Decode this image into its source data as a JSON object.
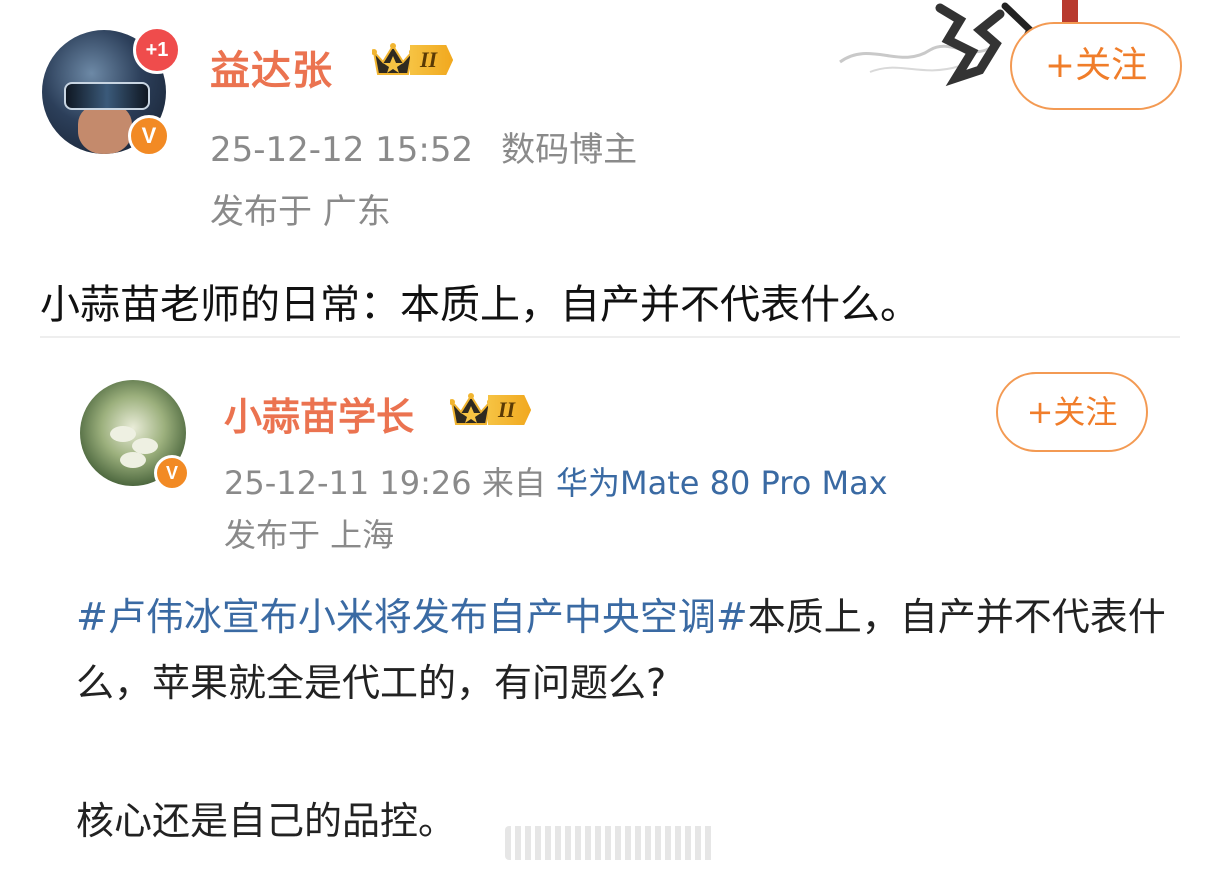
{
  "main_post": {
    "username": "益达张",
    "level": "II",
    "notification_badge": "+1",
    "verified_badge": "V",
    "follow_label": "+关注",
    "timestamp": "25-12-12 15:52",
    "role": "数码博主",
    "location": "发布于 广东",
    "text": "小蒜苗老师的日常：本质上，自产并不代表什么。"
  },
  "quoted_post": {
    "username": "小蒜苗学长",
    "level": "II",
    "verified_badge": "V",
    "follow_label": "+关注",
    "timestamp": "25-12-11 19:26",
    "source_prefix": "来自",
    "device": "华为Mate 80 Pro Max",
    "location": "发布于 上海",
    "hashtag": "#卢伟冰宣布小米将发布自产中央空调#",
    "body": "本质上，自产并不代表什么，苹果就全是代工的，有问题么?",
    "closing": "核心还是自己的品控。"
  },
  "colors": {
    "username": "#eb7350",
    "follow": "#f07d2a",
    "link": "#3a6aa3",
    "meta": "#8a8a8a"
  },
  "icons": [
    "crown-icon",
    "verified-v-icon",
    "ink-decoration-icon"
  ]
}
